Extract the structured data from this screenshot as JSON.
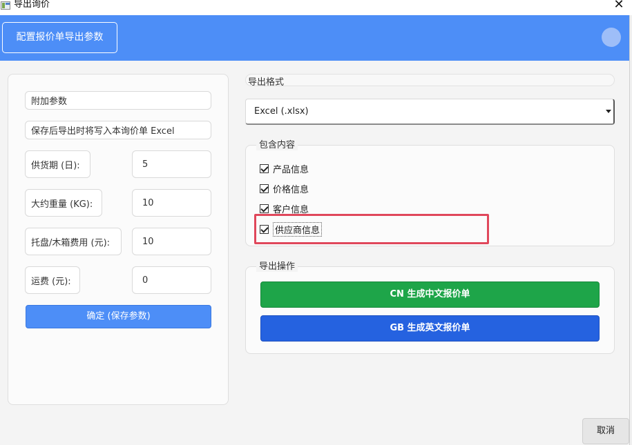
{
  "window": {
    "title": "导出询价",
    "close_label": "✕"
  },
  "header": {
    "button_label": "配置报价单导出参数"
  },
  "left_panel": {
    "section_label": "附加参数",
    "description": "保存后导出时将写入本询价单 Excel",
    "fields": [
      {
        "label": "供货期 (日):",
        "value": "5"
      },
      {
        "label": "大约重量 (KG):",
        "value": "10"
      },
      {
        "label": "托盘/木箱费用 (元):",
        "value": "10"
      },
      {
        "label": "运费 (元):",
        "value": "0"
      }
    ],
    "confirm_label": "确定 (保存参数)"
  },
  "export_format": {
    "label": "导出格式",
    "selected": "Excel (.xlsx)"
  },
  "include_content": {
    "label": "包含内容",
    "items": [
      {
        "label": "产品信息",
        "checked": true
      },
      {
        "label": "价格信息",
        "checked": true
      },
      {
        "label": "客户信息",
        "checked": true
      },
      {
        "label": "供应商信息",
        "checked": true
      }
    ]
  },
  "export_actions": {
    "label": "导出操作",
    "cn_label": "CN 生成中文报价单",
    "gb_label": "GB 生成英文报价单"
  },
  "footer": {
    "cancel_label": "取消"
  },
  "colors": {
    "header_blue": "#4d8ef7",
    "cn_green": "#1ea549",
    "gb_blue": "#2562e0",
    "highlight_red": "#e0475b"
  }
}
